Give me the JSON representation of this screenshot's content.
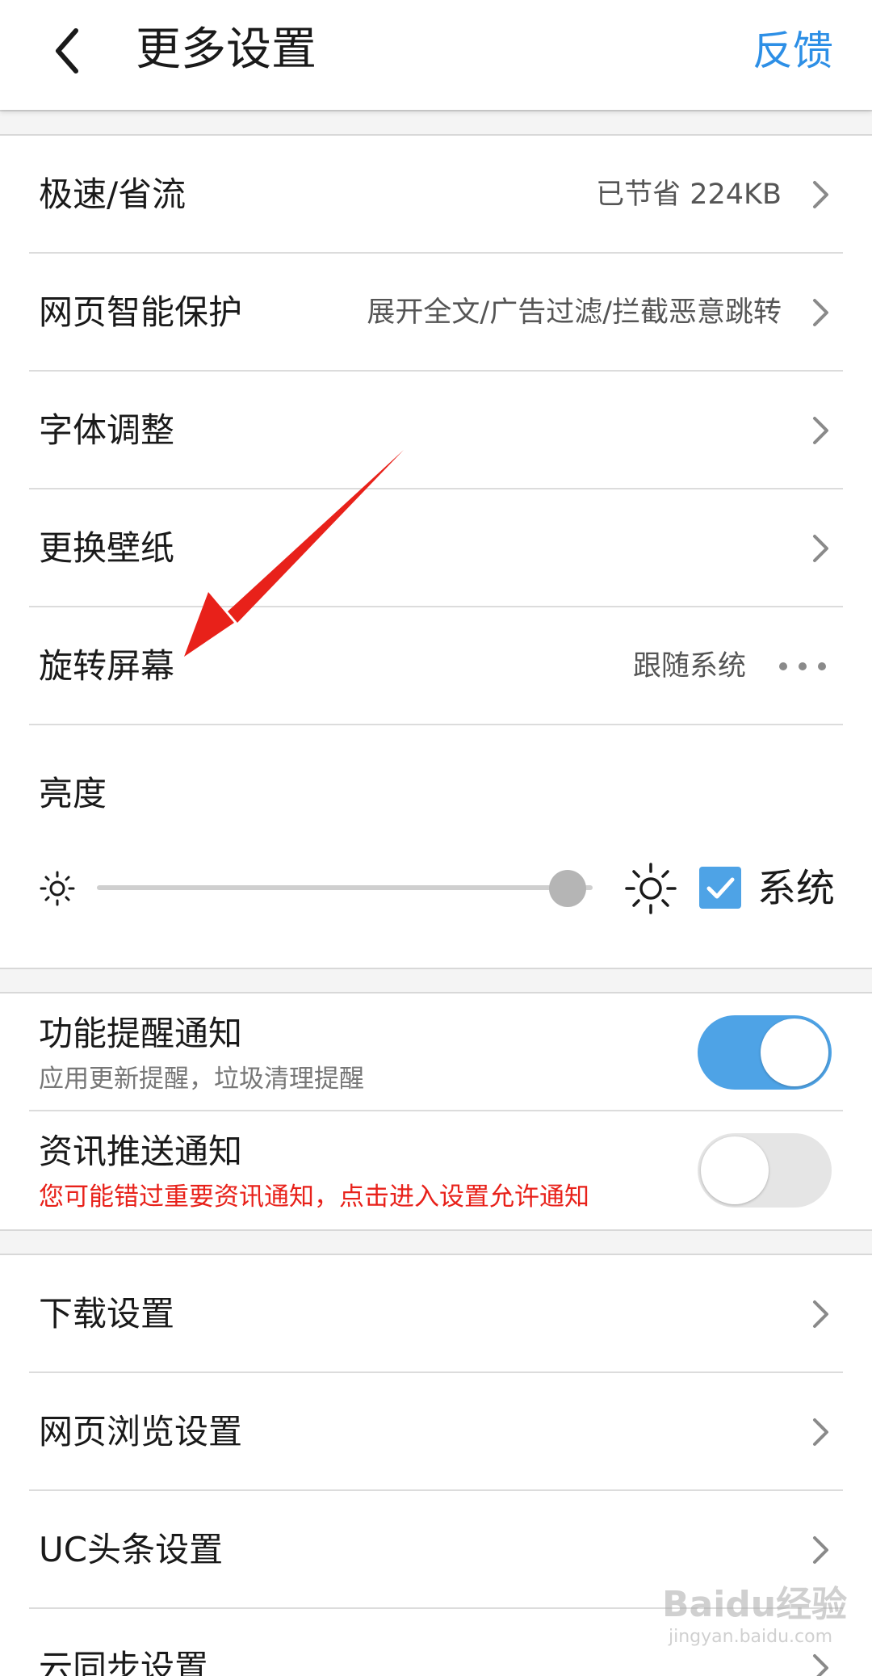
{
  "header": {
    "title": "更多设置",
    "feedback": "反馈"
  },
  "settings_group_1": [
    {
      "label": "极速/省流",
      "value": "已节省 224KB"
    },
    {
      "label": "网页智能保护",
      "value": "展开全文/广告过滤/拦截恶意跳转"
    },
    {
      "label": "字体调整",
      "value": ""
    },
    {
      "label": "更换壁纸",
      "value": ""
    },
    {
      "label": "旋转屏幕",
      "value": "跟随系统"
    }
  ],
  "brightness": {
    "label": "亮度",
    "level": 0.95,
    "system_label": "系统",
    "system_checked": true
  },
  "notifications": [
    {
      "title": "功能提醒通知",
      "subtitle": "应用更新提醒，垃圾清理提醒",
      "enabled": true
    },
    {
      "title": "资讯推送通知",
      "subtitle": "您可能错过重要资讯通知，点击进入设置允许通知",
      "enabled": false
    }
  ],
  "settings_group_2": [
    {
      "label": "下载设置"
    },
    {
      "label": "网页浏览设置"
    },
    {
      "label": "UC头条设置"
    },
    {
      "label": "云同步设置"
    }
  ],
  "watermark": {
    "brand": "Baidu经验",
    "url": "jingyan.baidu.com"
  },
  "colors": {
    "accent": "#2d8fe6",
    "toggle_on": "#4ea3e6",
    "warning": "#e8211a",
    "annotation_arrow": "#e8211a"
  }
}
